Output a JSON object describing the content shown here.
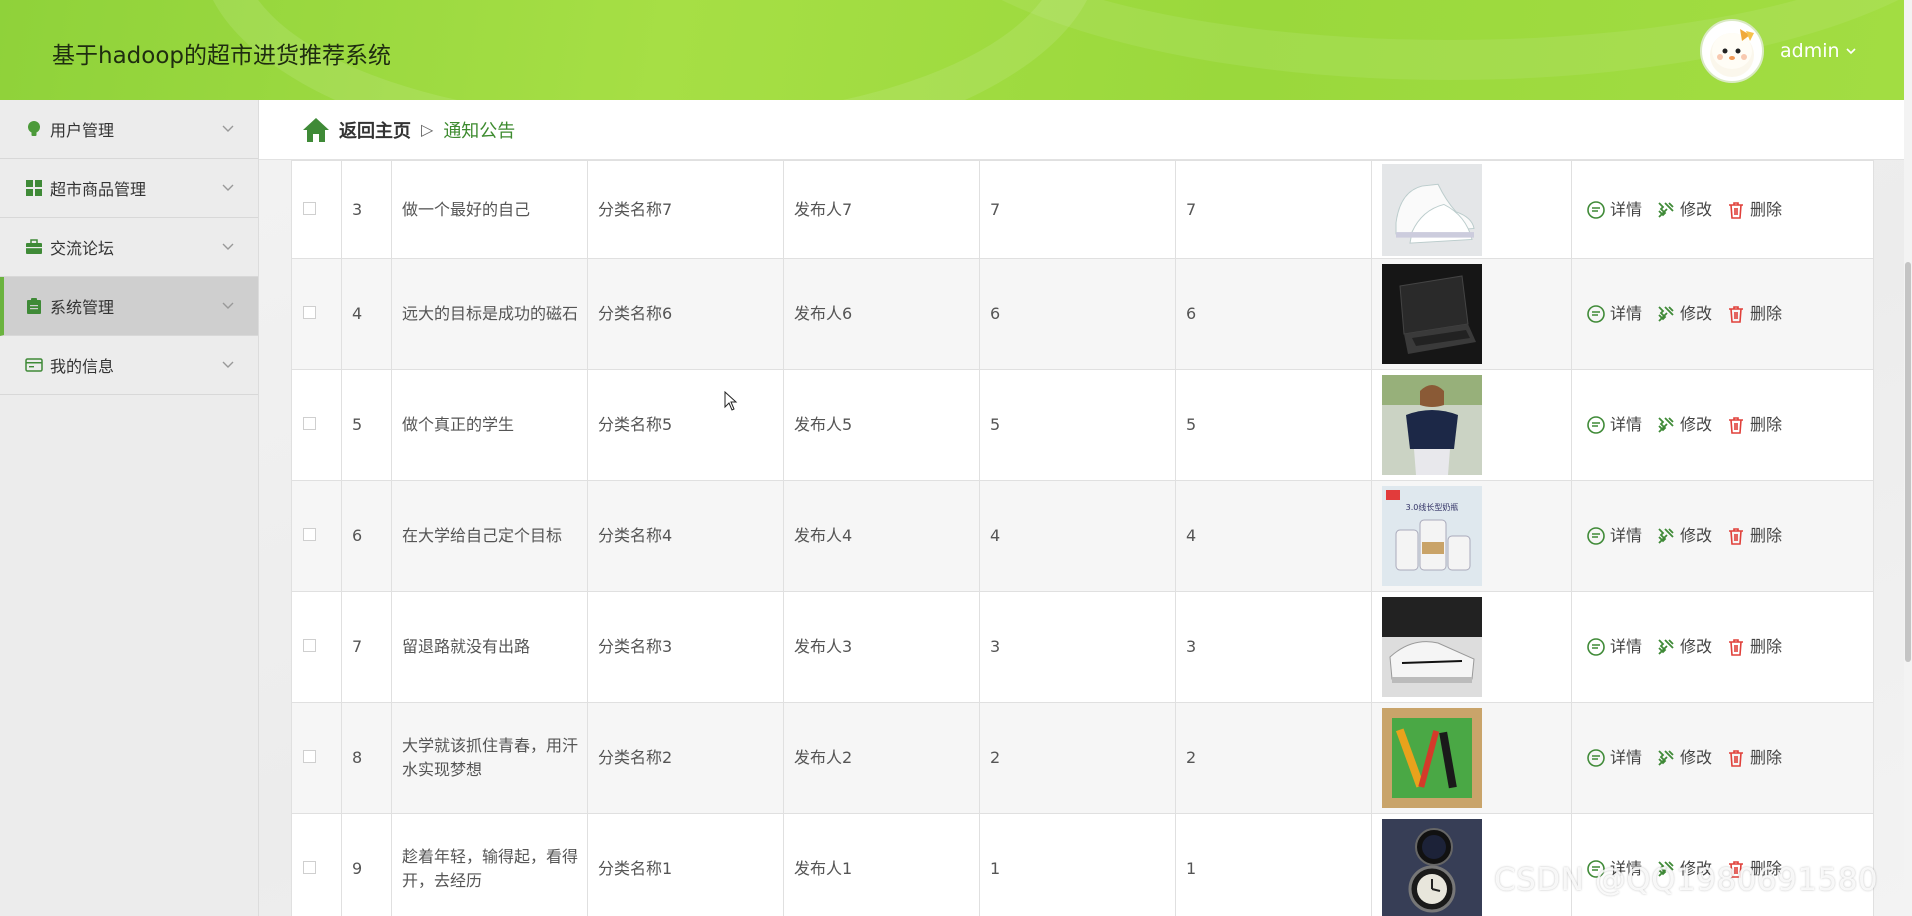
{
  "header": {
    "title": "基于hadoop的超市进货推荐系统",
    "username": "admin",
    "avatar_icon": "cartoon-avatar-icon"
  },
  "sidebar": {
    "items": [
      {
        "label": "用户管理",
        "icon": "lightbulb-icon"
      },
      {
        "label": "超市商品管理",
        "icon": "grid-icon"
      },
      {
        "label": "交流论坛",
        "icon": "briefcase-icon"
      },
      {
        "label": "系统管理",
        "icon": "clipboard-icon",
        "active": true
      },
      {
        "label": "我的信息",
        "icon": "card-icon"
      }
    ]
  },
  "breadcrumb": {
    "home": "返回主页",
    "separator": "▷",
    "current": "通知公告"
  },
  "table": {
    "rows": [
      {
        "idx": "3",
        "title": "做一个最好的自己",
        "category": "分类名称7",
        "publisher": "发布人7",
        "c1": "7",
        "c2": "7",
        "image": "white-sneakers"
      },
      {
        "idx": "4",
        "title": "远大的目标是成功的磁石",
        "category": "分类名称6",
        "publisher": "发布人6",
        "c1": "6",
        "c2": "6",
        "image": "laptop"
      },
      {
        "idx": "5",
        "title": "做个真正的学生",
        "category": "分类名称5",
        "publisher": "发布人5",
        "c1": "5",
        "c2": "5",
        "image": "woman-blouse"
      },
      {
        "idx": "6",
        "title": "在大学给自己定个目标",
        "category": "分类名称4",
        "publisher": "发布人4",
        "c1": "4",
        "c2": "4",
        "image": "milk-bottles",
        "image_text": "3.0线长型奶瓶"
      },
      {
        "idx": "7",
        "title": "留退路就没有出路",
        "category": "分类名称3",
        "publisher": "发布人3",
        "c1": "3",
        "c2": "3",
        "image": "off-white-sneakers"
      },
      {
        "idx": "8",
        "title": "大学就该抓住青春，用汗水实现梦想",
        "category": "分类名称2",
        "publisher": "发布人2",
        "c1": "2",
        "c2": "2",
        "image": "tool-kit"
      },
      {
        "idx": "9",
        "title": "趁着年轻，输得起，看得开，去经历",
        "category": "分类名称1",
        "publisher": "发布人1",
        "c1": "1",
        "c2": "1",
        "image": "wrist-watch"
      }
    ],
    "actions": {
      "detail": "详情",
      "edit": "修改",
      "delete": "删除"
    }
  },
  "colors": {
    "accent": "#6bb33f",
    "header": "#a6df45",
    "link": "#3d8b2f"
  },
  "watermark": "CSDN @QQ1980691580"
}
